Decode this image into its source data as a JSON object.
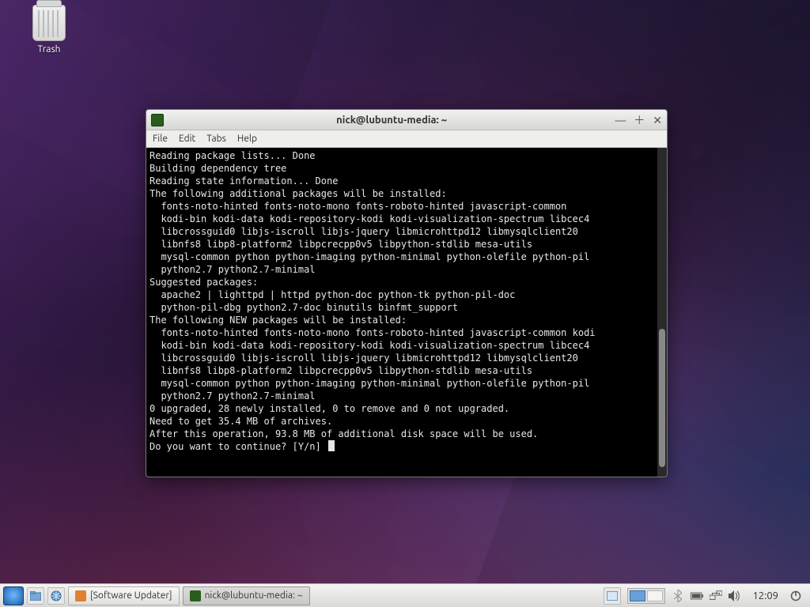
{
  "desktop": {
    "trash_label": "Trash"
  },
  "window": {
    "title": "nick@lubuntu-media: ~",
    "menu": {
      "file": "File",
      "edit": "Edit",
      "tabs": "Tabs",
      "help": "Help"
    }
  },
  "terminal": {
    "lines": [
      "Reading package lists... Done",
      "Building dependency tree",
      "Reading state information... Done",
      "The following additional packages will be installed:",
      "  fonts-noto-hinted fonts-noto-mono fonts-roboto-hinted javascript-common",
      "  kodi-bin kodi-data kodi-repository-kodi kodi-visualization-spectrum libcec4",
      "  libcrossguid0 libjs-iscroll libjs-jquery libmicrohttpd12 libmysqlclient20",
      "  libnfs8 libp8-platform2 libpcrecpp0v5 libpython-stdlib mesa-utils",
      "  mysql-common python python-imaging python-minimal python-olefile python-pil",
      "  python2.7 python2.7-minimal",
      "Suggested packages:",
      "  apache2 | lighttpd | httpd python-doc python-tk python-pil-doc",
      "  python-pil-dbg python2.7-doc binutils binfmt_support",
      "The following NEW packages will be installed:",
      "  fonts-noto-hinted fonts-noto-mono fonts-roboto-hinted javascript-common kodi",
      "  kodi-bin kodi-data kodi-repository-kodi kodi-visualization-spectrum libcec4",
      "  libcrossguid0 libjs-iscroll libjs-jquery libmicrohttpd12 libmysqlclient20",
      "  libnfs8 libp8-platform2 libpcrecpp0v5 libpython-stdlib mesa-utils",
      "  mysql-common python python-imaging python-minimal python-olefile python-pil",
      "  python2.7 python2.7-minimal",
      "0 upgraded, 28 newly installed, 0 to remove and 0 not upgraded.",
      "Need to get 35.4 MB of archives.",
      "After this operation, 93.8 MB of additional disk space will be used."
    ],
    "prompt": "Do you want to continue? [Y/n] "
  },
  "taskbar": {
    "task1": "[Software Updater]",
    "task2": "nick@lubuntu-media: ~",
    "clock": "12:09"
  }
}
